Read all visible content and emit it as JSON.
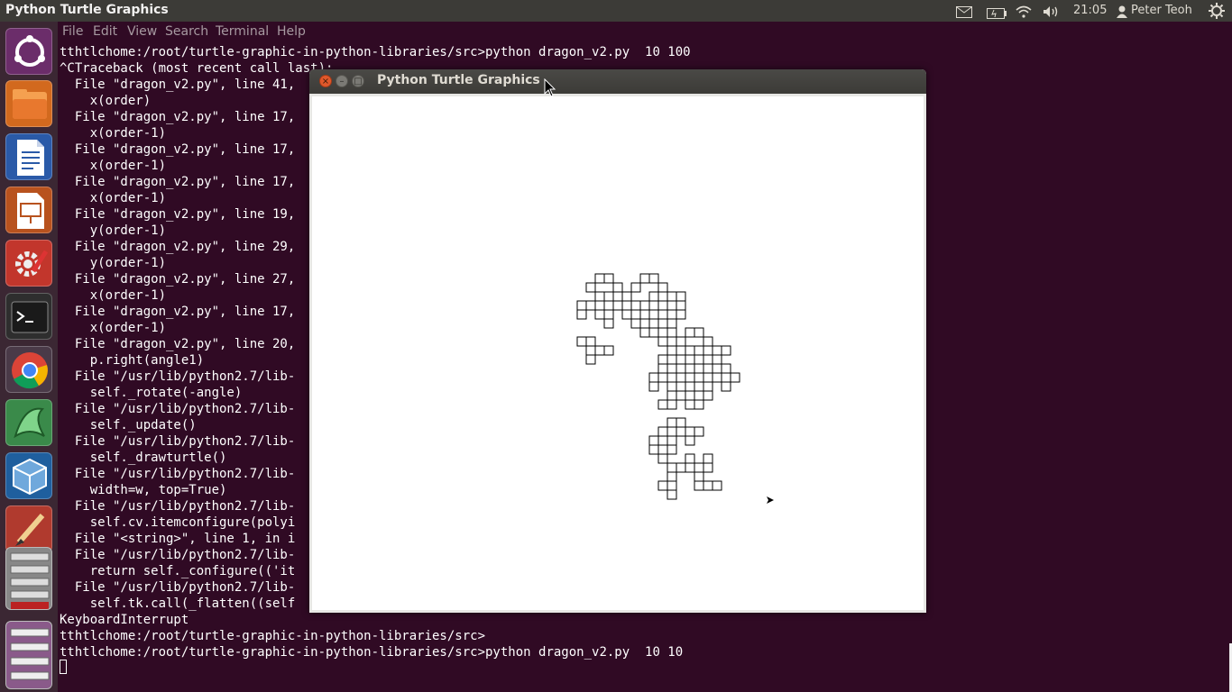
{
  "topbar": {
    "app_title": "Python Turtle Graphics",
    "indicators": [
      {
        "name": "mail-icon"
      },
      {
        "name": "battery-icon"
      },
      {
        "name": "wifi-icon"
      },
      {
        "name": "volume-icon"
      }
    ],
    "time": "21:05",
    "user": "Peter Teoh"
  },
  "launcher": {
    "items": [
      {
        "name": "ubuntu-dash-icon"
      },
      {
        "name": "files-icon"
      },
      {
        "name": "libreoffice-writer-icon"
      },
      {
        "name": "libreoffice-impress-icon"
      },
      {
        "name": "system-settings-icon"
      },
      {
        "name": "terminal-icon"
      },
      {
        "name": "chrome-icon"
      },
      {
        "name": "inkscape-icon"
      },
      {
        "name": "virtualbox-icon"
      },
      {
        "name": "paint-icon"
      },
      {
        "name": "workspace-stack-icon"
      },
      {
        "name": "trash-stack-icon"
      }
    ]
  },
  "terminal": {
    "menu": [
      "File",
      "Edit",
      "View",
      "Search",
      "Terminal",
      "Help"
    ],
    "lines": [
      "tthtlchome:/root/turtle-graphic-in-python-libraries/src>python dragon_v2.py  10 100",
      "^CTraceback (most recent call last):",
      "  File \"dragon_v2.py\", line 41,",
      "    x(order)",
      "  File \"dragon_v2.py\", line 17,",
      "    x(order-1)",
      "  File \"dragon_v2.py\", line 17,",
      "    x(order-1)",
      "  File \"dragon_v2.py\", line 17,",
      "    x(order-1)",
      "  File \"dragon_v2.py\", line 19,",
      "    y(order-1)",
      "  File \"dragon_v2.py\", line 29,",
      "    y(order-1)",
      "  File \"dragon_v2.py\", line 27,",
      "    x(order-1)",
      "  File \"dragon_v2.py\", line 17,",
      "    x(order-1)",
      "  File \"dragon_v2.py\", line 20,",
      "    p.right(angle1)",
      "  File \"/usr/lib/python2.7/lib-",
      "    self._rotate(-angle)",
      "  File \"/usr/lib/python2.7/lib-",
      "    self._update()",
      "  File \"/usr/lib/python2.7/lib-",
      "    self._drawturtle()",
      "  File \"/usr/lib/python2.7/lib-",
      "    width=w, top=True)",
      "  File \"/usr/lib/python2.7/lib-",
      "    self.cv.itemconfigure(polyi",
      "  File \"<string>\", line 1, in i",
      "  File \"/usr/lib/python2.7/lib-",
      "    return self._configure(('it",
      "  File \"/usr/lib/python2.7/lib-",
      "    self.tk.call(_flatten((self",
      "KeyboardInterrupt",
      "tthtlchome:/root/turtle-graphic-in-python-libraries/src>",
      "tthtlchome:/root/turtle-graphic-in-python-libraries/src>python dragon_v2.py  10 10"
    ]
  },
  "turtle_window": {
    "title": "Python Turtle Graphics",
    "buttons": [
      {
        "name": "close-button",
        "glyph": "×",
        "color": "#e0582b"
      },
      {
        "name": "minimize-button",
        "glyph": "–",
        "color": "#7b7a75"
      },
      {
        "name": "maximize-button",
        "glyph": "□",
        "color": "#7b7a75"
      }
    ]
  },
  "colors": {
    "terminal_bg": "#300a24",
    "panel_bg": "#3c3b37",
    "launcher_bg": "#3b2733",
    "accent_close": "#e0582b"
  }
}
